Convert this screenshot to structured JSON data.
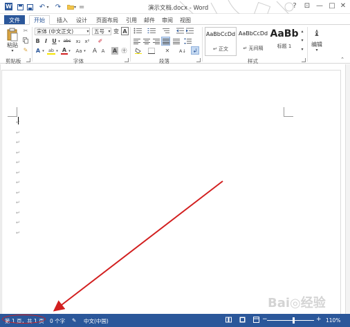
{
  "app": {
    "title": "演示文档.docx - Word"
  },
  "quick_access": {
    "undo_glyph": "↶",
    "redo_glyph": "↷",
    "separator": "="
  },
  "window_controls": {
    "help": "?",
    "restore": "⊡",
    "minimize": "—",
    "maximize": "□",
    "close": "✕"
  },
  "tabs": [
    "文件",
    "开始",
    "插入",
    "设计",
    "页面布局",
    "引用",
    "邮件",
    "审阅",
    "视图"
  ],
  "clipboard": {
    "paste_label": "粘贴",
    "group_label": "剪贴板"
  },
  "font": {
    "font_name": "宋体 (中文正文)",
    "font_size": "五号",
    "grow_icon": "变",
    "format_icon": "A",
    "bold": "B",
    "italic": "I",
    "underline": "U",
    "strike": "abc",
    "subscript": "x₂",
    "superscript": "x²",
    "clear_icon": "✐",
    "text_effects": "A",
    "highlight": "ab",
    "font_color": "A",
    "change_case": "Aa",
    "grow": "A",
    "shrink": "A",
    "char_border": "A",
    "enclose": "㊉",
    "group_label": "字体"
  },
  "paragraph": {
    "group_label": "段落",
    "sort_icon": "A↓",
    "show_marks": "↲"
  },
  "styles": {
    "group_label": "样式",
    "items": [
      {
        "sample": "AaBbCcDd",
        "name": "↵ 正文"
      },
      {
        "sample": "AaBbCcDd",
        "name": "↵ 无间隔"
      },
      {
        "sample": "AaBb",
        "name": "标题 1"
      }
    ]
  },
  "editing": {
    "label": "编辑",
    "icon": "♝"
  },
  "document": {
    "paragraph_mark": "↵",
    "mark_count": 12
  },
  "status": {
    "page_info": "第 1 页，共 1 页",
    "word_count": "0 个字",
    "proof_icon": "✎",
    "language": "中文(中国)",
    "zoom_minus": "−",
    "zoom_plus": "+",
    "zoom": "110%"
  },
  "watermark": "Bai◎经验",
  "colors": {
    "accent": "#2b579a",
    "callout": "#d21f1f"
  }
}
